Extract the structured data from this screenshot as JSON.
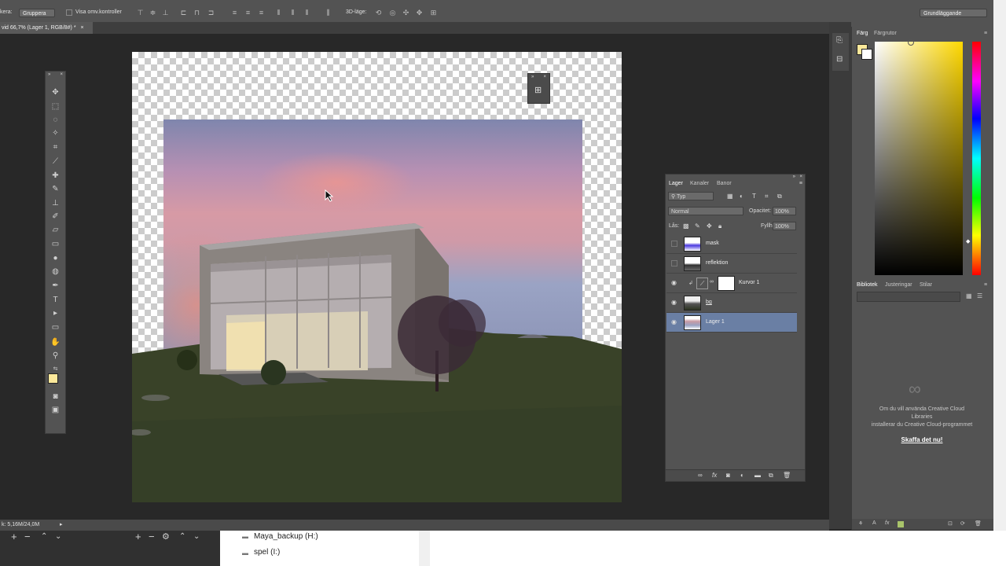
{
  "optbar": {
    "left_label": "kera:",
    "group_select": "Gruppera",
    "transform_label": "Visa omv.kontroller",
    "mode_3d": "3D-läge:",
    "workspace": "Grundläggande"
  },
  "doc": {
    "tab_title": "vid 66,7% (Lager 1, RGB/8#) *",
    "status": "k: 5,16M/24,0M"
  },
  "layers_panel": {
    "tabs": [
      "Lager",
      "Kanaler",
      "Banor"
    ],
    "filter": "Typ",
    "blend_mode": "Normal",
    "opacity_label": "Opacitet:",
    "opacity_value": "100%",
    "lock_label": "Lås:",
    "fill_label": "Fyllh",
    "fill_value": "100%",
    "layers": [
      {
        "name": "mask",
        "visible": false
      },
      {
        "name": "reflektion",
        "visible": false
      },
      {
        "name": "Kurvor 1",
        "visible": true
      },
      {
        "name": "bg",
        "visible": true
      },
      {
        "name": "Lager 1",
        "visible": true,
        "selected": true
      }
    ]
  },
  "color_panel": {
    "tabs": [
      "Färg",
      "Färgrutor"
    ],
    "foreground": "#fbe89a",
    "background": "#ffffff"
  },
  "library_panel": {
    "tabs": [
      "Bibliotek",
      "Justeringar",
      "Stilar"
    ],
    "message_line1": "Om du vill använda Creative Cloud",
    "message_line2": "Libraries",
    "message_line3": "installerar du Creative Cloud-programmet",
    "link": "Skaffa det nu!"
  },
  "desktop": {
    "drives": [
      "Maya_backup (H:)",
      "spel (I:)"
    ]
  },
  "colors": {
    "selected_layer": "#6a7fa4",
    "panel": "#535353",
    "workspace": "#282828"
  }
}
